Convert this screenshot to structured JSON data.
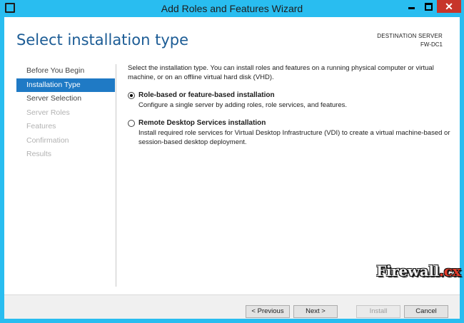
{
  "window": {
    "title": "Add Roles and Features Wizard",
    "accent_color": "#29bdf0",
    "close_color": "#c7352b"
  },
  "header": {
    "page_title": "Select installation type",
    "destination_label": "DESTINATION SERVER",
    "destination_value": "FW-DC1"
  },
  "nav": {
    "active_color": "#1f7ac5",
    "items": [
      {
        "label": "Before You Begin",
        "state": "enabled"
      },
      {
        "label": "Installation Type",
        "state": "active"
      },
      {
        "label": "Server Selection",
        "state": "enabled"
      },
      {
        "label": "Server Roles",
        "state": "disabled"
      },
      {
        "label": "Features",
        "state": "disabled"
      },
      {
        "label": "Confirmation",
        "state": "disabled"
      },
      {
        "label": "Results",
        "state": "disabled"
      }
    ]
  },
  "content": {
    "intro": "Select the installation type. You can install roles and features on a running physical computer or virtual machine, or on an offline virtual hard disk (VHD).",
    "options": [
      {
        "title": "Role-based or feature-based installation",
        "description": "Configure a single server by adding roles, role services, and features.",
        "selected": true
      },
      {
        "title": "Remote Desktop Services installation",
        "description": "Install required role services for Virtual Desktop Infrastructure (VDI) to create a virtual machine-based or session-based desktop deployment.",
        "selected": false
      }
    ]
  },
  "footer": {
    "previous_label": "< Previous",
    "next_label": "Next >",
    "install_label": "Install",
    "cancel_label": "Cancel",
    "install_enabled": false
  },
  "watermark": {
    "text_main": "Firewall",
    "text_dot": ".cx"
  }
}
